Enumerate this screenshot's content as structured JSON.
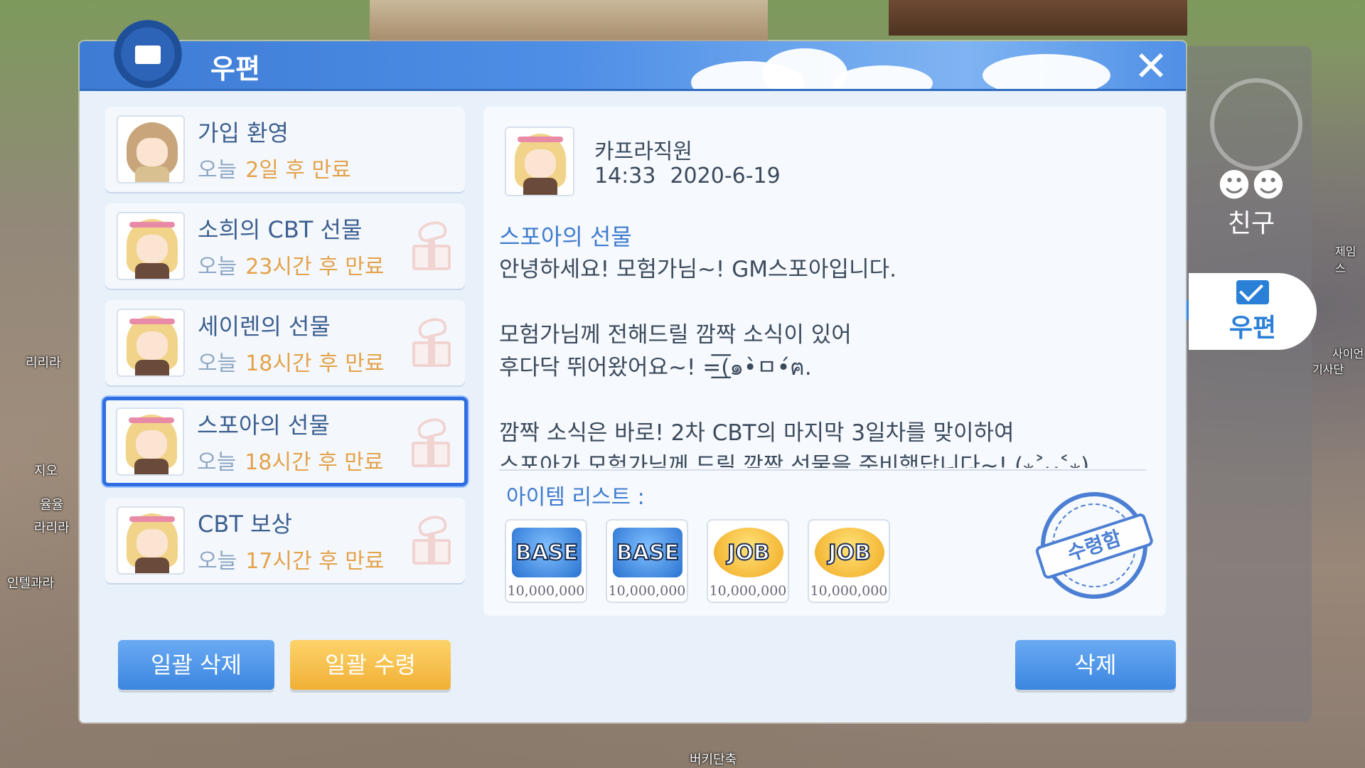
{
  "background": {
    "names": [
      "리리라",
      "지오",
      "율율",
      "라리라",
      "인텔과라",
      "제임스",
      "사이언",
      "기사단",
      "버키단축"
    ]
  },
  "side_panel": {
    "friend_label": "친구",
    "mail_label": "우편"
  },
  "header": {
    "title": "우편",
    "close_symbol": "✕"
  },
  "mail_list": [
    {
      "title": "가입 환영",
      "day": "오늘",
      "expires": "2일 후 만료",
      "sender_type": "male",
      "has_gift": false,
      "selected": false
    },
    {
      "title": "소희의 CBT 선물",
      "day": "오늘",
      "expires": "23시간 후 만료",
      "sender_type": "female",
      "has_gift": true,
      "selected": false
    },
    {
      "title": "세이렌의 선물",
      "day": "오늘",
      "expires": "18시간 후 만료",
      "sender_type": "female",
      "has_gift": true,
      "selected": false
    },
    {
      "title": "스포아의 선물",
      "day": "오늘",
      "expires": "18시간 후 만료",
      "sender_type": "female",
      "has_gift": true,
      "selected": true
    },
    {
      "title": "CBT 보상",
      "day": "오늘",
      "expires": "17시간 후 만료",
      "sender_type": "female",
      "has_gift": true,
      "selected": false
    }
  ],
  "detail": {
    "sender_name": "카프라직원",
    "time": "14:33",
    "date": "2020-6-19",
    "subject": "스포아의 선물",
    "body": [
      "안녕하세요! 모험가님~! GM스포아입니다.",
      "",
      "모험가님께 전해드릴 깜짝 소식이 있어",
      "후다닥 뛰어왔어요~! =͟͟͞͞(๑•̀ㅁ•́ฅ.",
      "",
      "깜짝 소식은 바로! 2차 CBT의 마지막 3일차를 맞이하여",
      "스포아가 모험가님께 드릴 깜짝 선물을 준비했답니다~! (⁎˃ᴗ˂⁎)"
    ],
    "items_label": "아이템 리스트 :",
    "rewards": [
      {
        "type": "BASE",
        "amount": "10,000,000"
      },
      {
        "type": "BASE",
        "amount": "10,000,000"
      },
      {
        "type": "JOB",
        "amount": "10,000,000"
      },
      {
        "type": "JOB",
        "amount": "10,000,000"
      }
    ],
    "stamp_label": "수령함"
  },
  "buttons": {
    "delete_all": "일괄 삭제",
    "receive_all": "일괄 수령",
    "delete": "삭제"
  },
  "colors": {
    "accent_blue": "#3c86e0",
    "accent_gold": "#f1b035",
    "expiry_orange": "#e4a24a",
    "selected_border": "#2f6ee0"
  }
}
